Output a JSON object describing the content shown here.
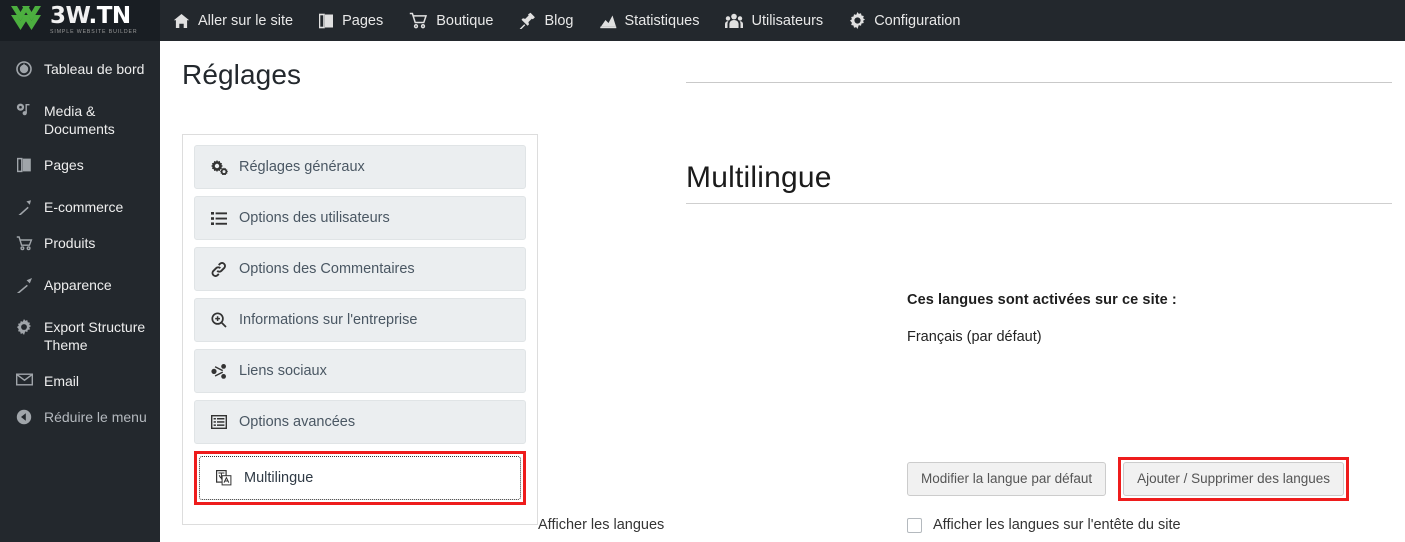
{
  "brand": {
    "title_main": "3W",
    "title_dot": ".TN",
    "tagline": "SIMPLE WEBSITE BUILDER",
    "logo_icon": "green-chevrons-logo-icon",
    "accent_color": "#4caf3f"
  },
  "topnav": {
    "items": [
      {
        "label": "Aller sur le site",
        "icon": "home-icon"
      },
      {
        "label": "Pages",
        "icon": "pages-icon"
      },
      {
        "label": "Boutique",
        "icon": "shopping-cart-icon"
      },
      {
        "label": "Blog",
        "icon": "pushpin-icon"
      },
      {
        "label": "Statistiques",
        "icon": "chart-icon"
      },
      {
        "label": "Utilisateurs",
        "icon": "users-icon"
      },
      {
        "label": "Configuration",
        "icon": "gear-icon"
      }
    ]
  },
  "sidebar": {
    "items": [
      {
        "label": "Tableau de bord",
        "icon": "dashboard-icon",
        "sep_after": true
      },
      {
        "label": "Media & Documents",
        "icon": "media-icon",
        "sep_after": false
      },
      {
        "label": "Pages",
        "icon": "pages-icon",
        "sep_after": true
      },
      {
        "label": "E-commerce",
        "icon": "ecommerce-icon",
        "sep_after": false
      },
      {
        "label": "Produits",
        "icon": "cart-icon",
        "sep_after": true
      },
      {
        "label": "Apparence",
        "icon": "brush-icon",
        "sep_after": true
      },
      {
        "label": "Export Structure Theme",
        "icon": "gear-icon",
        "sep_after": false
      },
      {
        "label": "Email",
        "icon": "envelope-icon",
        "sep_after": false
      },
      {
        "label": "Réduire le menu",
        "icon": "collapse-arrow-icon",
        "sep_after": false
      }
    ]
  },
  "page": {
    "title": "Réglages"
  },
  "settings_list": [
    {
      "label": "Réglages généraux",
      "icon": "cogs-icon",
      "active": false
    },
    {
      "label": "Options des utilisateurs",
      "icon": "list-icon",
      "active": false
    },
    {
      "label": "Options des Commentaires",
      "icon": "link-icon",
      "active": false
    },
    {
      "label": "Informations sur l'entreprise",
      "icon": "search-plus-icon",
      "active": false
    },
    {
      "label": "Liens sociaux",
      "icon": "share-icon",
      "active": false
    },
    {
      "label": "Options avancées",
      "icon": "list-alt-icon",
      "active": false
    },
    {
      "label": "Multilingue",
      "icon": "language-flag-icon",
      "active": true
    }
  ],
  "detail": {
    "title": "Multilingue",
    "langs_heading": "Ces langues sont activées sur ce site :",
    "default_language": "Français (par défaut)",
    "buttons": {
      "edit_default": "Modifier la langue par défaut",
      "add_remove": "Ajouter / Supprimer des langues"
    },
    "show_langs": {
      "label": "Afficher les langues",
      "checkbox_label": "Afficher les langues sur l'entête du site",
      "checked": false
    }
  },
  "highlight_color": "#ee1c1c"
}
